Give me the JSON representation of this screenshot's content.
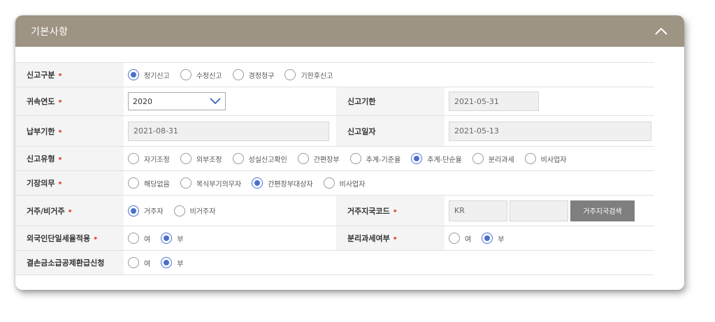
{
  "header": {
    "title": "기본사항"
  },
  "rows": {
    "report_type": {
      "label": "신고구분",
      "options": [
        "정기신고",
        "수정신고",
        "경정청구",
        "기한후신고"
      ],
      "selected": 0
    },
    "year": {
      "label": "귀속연도",
      "value": "2020"
    },
    "deadline": {
      "label": "신고기한",
      "value": "2021-05-31"
    },
    "payment_deadline": {
      "label": "납부기한",
      "value": "2021-08-31"
    },
    "report_date": {
      "label": "신고일자",
      "value": "2021-05-13"
    },
    "report_kind": {
      "label": "신고유형",
      "options": [
        "자기조정",
        "외부조정",
        "성실신고확인",
        "간편장부",
        "추계-기준율",
        "추계-단순율",
        "분리과세",
        "비사업자"
      ],
      "selected": 5
    },
    "bookkeeping": {
      "label": "기장의무",
      "options": [
        "해당없음",
        "복식부기의무자",
        "간편장부대상자",
        "비사업자"
      ],
      "selected": 2
    },
    "residency": {
      "label": "거주/비거주",
      "options": [
        "거주자",
        "비거주자"
      ],
      "selected": 0
    },
    "country_code": {
      "label": "거주지국코드",
      "value": "KR",
      "value2": "",
      "button": "거주지국검색"
    },
    "foreigner_rate": {
      "label": "외국인단일세율적용",
      "options": [
        "여",
        "부"
      ],
      "selected": 1
    },
    "separate_tax": {
      "label": "분리과세여부",
      "options": [
        "여",
        "부"
      ],
      "selected": 1
    },
    "deficit_refund": {
      "label": "결손금소급공제환급신청",
      "options": [
        "여",
        "부"
      ],
      "selected": 1
    }
  },
  "required_mark": "•",
  "colors": {
    "header_bg": "#9e9484",
    "radio_on": "#4a6fcf",
    "required": "#e8533b",
    "button_bg": "#7f7f7f"
  }
}
